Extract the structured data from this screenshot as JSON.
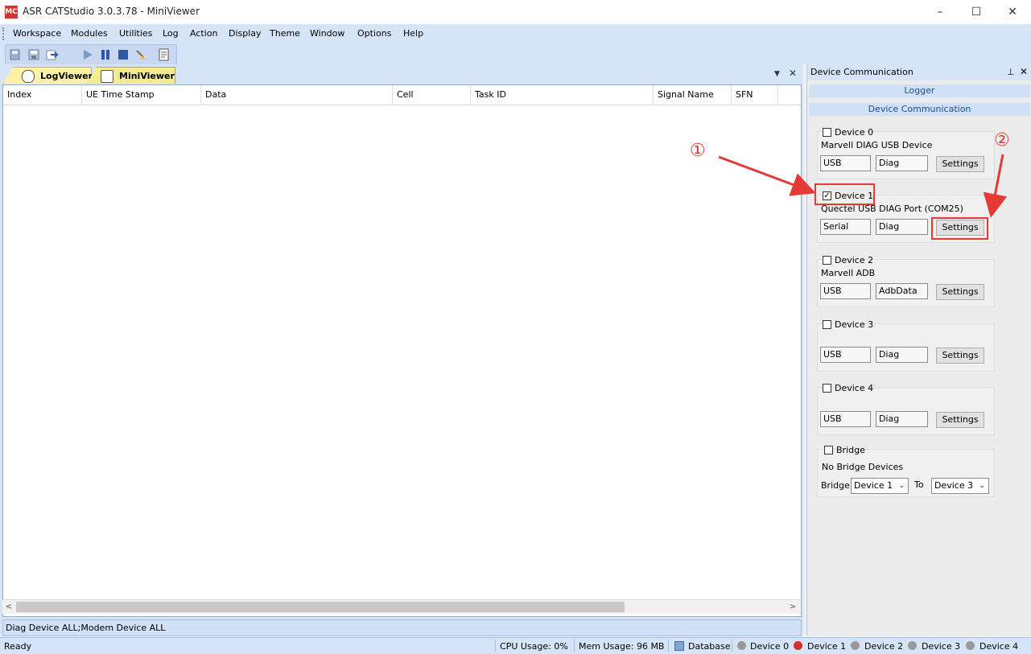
{
  "window": {
    "title": "ASR CATStudio 3.0.3.78 - MiniViewer",
    "app_icon_text": "MC",
    "minimize_glyph": "–",
    "maximize_glyph": "☐",
    "close_glyph": "✕"
  },
  "menu": [
    "Workspace",
    "Modules",
    "Utilities",
    "Log",
    "Action",
    "Display",
    "Theme",
    "Window",
    "Options",
    "Help"
  ],
  "toolbar": {
    "icons": [
      "save-all-icon",
      "save-icon",
      "import-icon",
      "play-icon",
      "pause-icon",
      "stop-icon",
      "clear-icon",
      "report-icon"
    ]
  },
  "tabs": [
    {
      "label": "LogViewer",
      "icon": "magnifier-icon"
    },
    {
      "label": "MiniViewer",
      "icon": "mil-icon"
    }
  ],
  "grid": {
    "columns": [
      "Index",
      "UE Time Stamp",
      "Data",
      "Cell",
      "Task ID",
      "Signal Name",
      "SFN"
    ]
  },
  "info_bar": "Diag Device ALL;Modem Device ALL",
  "right_panel": {
    "title": "Device Communication",
    "sections": [
      "Logger",
      "Device Communication"
    ],
    "devices": [
      {
        "label": "Device 0",
        "checked": false,
        "description": "Marvell DIAG USB Device",
        "interface": "USB",
        "mode": "Diag",
        "button": "Settings"
      },
      {
        "label": "Device 1",
        "checked": true,
        "description": "Quectel USB DIAG Port (COM25)",
        "interface": "Serial",
        "mode": "Diag",
        "button": "Settings"
      },
      {
        "label": "Device 2",
        "checked": false,
        "description": "Marvell ADB",
        "interface": "USB",
        "mode": "AdbData",
        "button": "Settings"
      },
      {
        "label": "Device 3",
        "checked": false,
        "description": "",
        "interface": "USB",
        "mode": "Diag",
        "button": "Settings"
      },
      {
        "label": "Device 4",
        "checked": false,
        "description": "",
        "interface": "USB",
        "mode": "Diag",
        "button": "Settings"
      }
    ],
    "bridge": {
      "label": "Bridge",
      "checked": false,
      "status": "No Bridge Devices",
      "row_label": "Bridge",
      "from": "Device 1",
      "to_label": "To",
      "to": "Device 3"
    }
  },
  "status_bar": {
    "ready": "Ready",
    "cpu": "CPU Usage:  0%",
    "mem": "Mem Usage: 96 MB",
    "database": "Database",
    "devices": [
      {
        "label": "Device 0",
        "color": "#9a9a9a"
      },
      {
        "label": "Device 1",
        "color": "#d32f2f"
      },
      {
        "label": "Device 2",
        "color": "#9a9a9a"
      },
      {
        "label": "Device 3",
        "color": "#9a9a9a"
      },
      {
        "label": "Device 4",
        "color": "#9a9a9a"
      }
    ]
  },
  "annotations": {
    "marker1": "①",
    "marker2": "②",
    "color": "#e53935"
  }
}
